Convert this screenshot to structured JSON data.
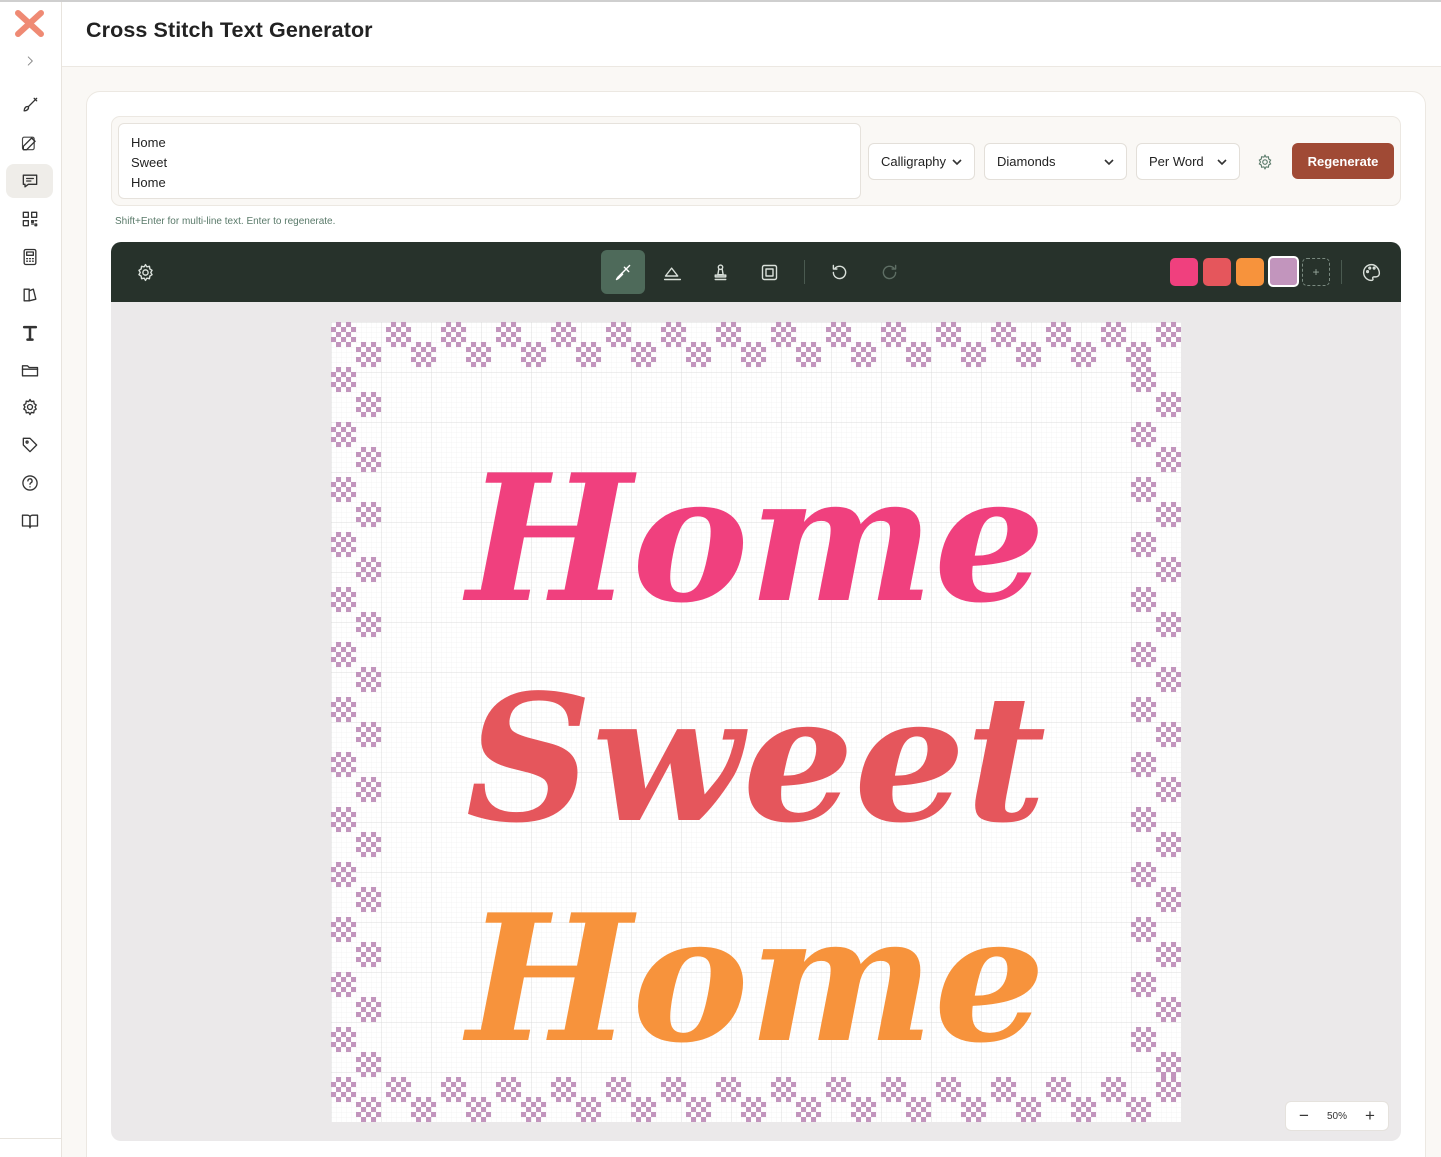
{
  "app": {
    "title": "Cross Stitch Text Generator"
  },
  "sidebar": {
    "items": [
      {
        "name": "expand-chevron-icon"
      },
      {
        "name": "brush-icon"
      },
      {
        "name": "edit-icon"
      },
      {
        "name": "chat-icon",
        "active": true
      },
      {
        "name": "qr-code-icon"
      },
      {
        "name": "calculator-icon"
      },
      {
        "name": "layers-icon"
      },
      {
        "name": "text-icon"
      },
      {
        "name": "folder-icon"
      },
      {
        "name": "settings-icon"
      },
      {
        "name": "tag-icon"
      },
      {
        "name": "help-icon"
      },
      {
        "name": "book-icon"
      }
    ]
  },
  "controls": {
    "text_lines": [
      "Home",
      "Sweet",
      "Home"
    ],
    "font_select": "Calligraphy",
    "border_select": "Diamonds",
    "color_mode_select": "Per Word",
    "regenerate_label": "Regenerate",
    "hint": "Shift+Enter for multi-line text. Enter to regenerate."
  },
  "editor": {
    "tools": [
      "settings",
      "brush",
      "eraser",
      "stamp",
      "frame",
      "undo",
      "redo",
      "palette"
    ],
    "active_tool": "brush",
    "palette": [
      {
        "color": "#f0407e"
      },
      {
        "color": "#e5565c"
      },
      {
        "color": "#f7933c"
      },
      {
        "color": "#c295bd",
        "selected": true
      }
    ],
    "add_color_label": "+",
    "zoom_label": "50%",
    "zoom_minus": "−",
    "zoom_plus": "+"
  },
  "pattern": {
    "words": [
      {
        "text": "Home",
        "color": "#f0407e"
      },
      {
        "text": "Sweet",
        "color": "#e5565c"
      },
      {
        "text": "Home",
        "color": "#f7933c"
      }
    ],
    "border_style": "Diamonds",
    "border_color": "#c295bd",
    "font": "Calligraphy"
  }
}
